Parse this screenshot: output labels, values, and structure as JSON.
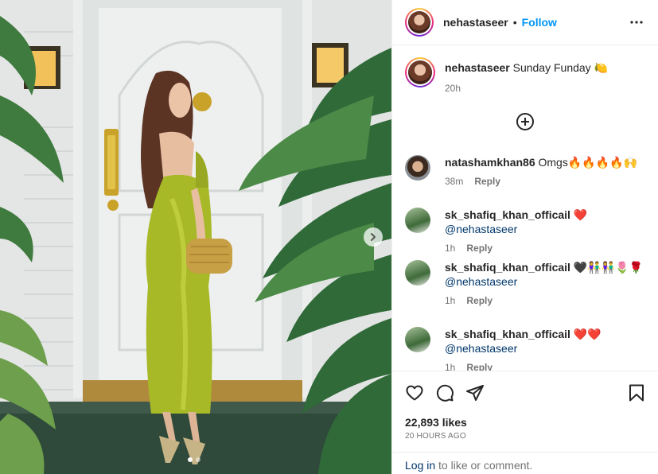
{
  "post": {
    "username": "nehastaseer",
    "follow_label": "Follow",
    "separator": "•",
    "caption_text": "Sunday Funday",
    "caption_emoji": "🍋",
    "caption_time": "20h",
    "likes": "22,893 likes",
    "posted_ago": "20 HOURS AGO"
  },
  "carousel": {
    "total": 2,
    "current": 1
  },
  "comments": [
    {
      "username": "natashamkhan86",
      "text": "Omgs",
      "emoji": "🔥🔥🔥🔥🙌",
      "mention": "",
      "time": "38m",
      "reply_label": "Reply"
    },
    {
      "username": "sk_shafiq_khan_officail",
      "text": "",
      "emoji": "❤️",
      "mention": "@nehastaseer",
      "time": "1h",
      "reply_label": "Reply"
    },
    {
      "username": "sk_shafiq_khan_officail",
      "text": "",
      "emoji": "🖤👫👫🌷🌹",
      "mention": "@nehastaseer",
      "time": "1h",
      "reply_label": "Reply"
    },
    {
      "username": "sk_shafiq_khan_officail",
      "text": "",
      "emoji": "❤️❤️",
      "mention": "@nehastaseer",
      "time": "1h",
      "reply_label": "Reply"
    }
  ],
  "login_prompt": {
    "link": "Log in",
    "rest": " to like or comment."
  },
  "colors": {
    "accent": "#0095f6",
    "muted": "#737373",
    "mention": "#00376b",
    "dress": "#a8b928"
  }
}
